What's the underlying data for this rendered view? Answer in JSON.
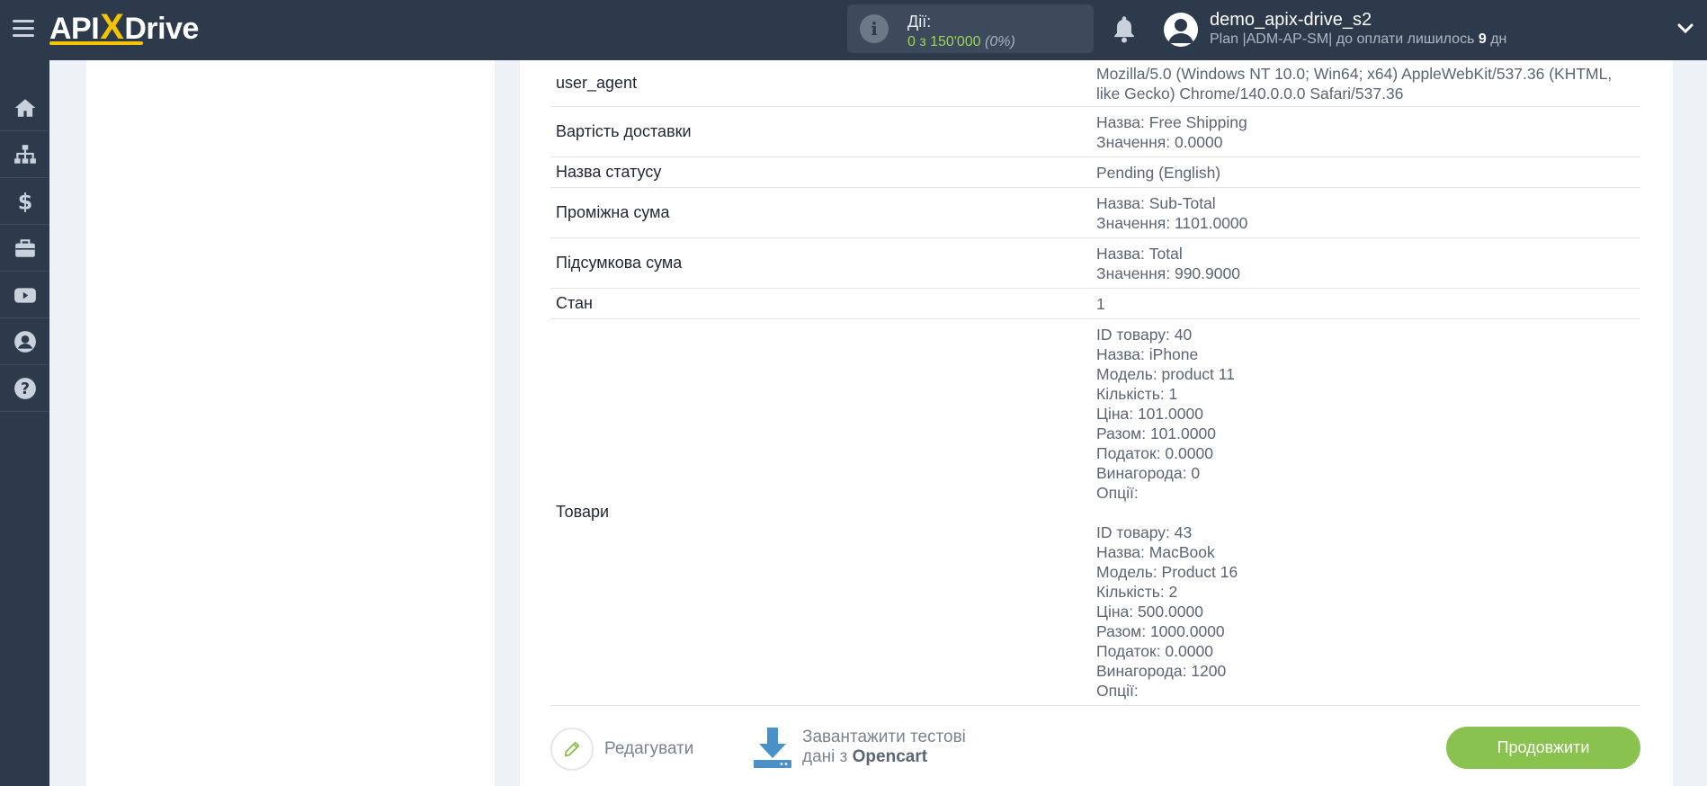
{
  "header": {
    "logo": {
      "left": "API",
      "x": "X",
      "right": "Drive"
    },
    "actions": {
      "label": "Дії:",
      "value": "0 з 150'000",
      "percent": "(0%)"
    },
    "user": {
      "name": "demo_apix-drive_s2",
      "plan_prefix": "Plan |ADM-AP-SM| до оплати лишилось ",
      "days": "9",
      "days_suffix": " дн"
    }
  },
  "sidebar": {
    "items": [
      "home-icon",
      "sitemap-icon",
      "dollar-icon",
      "briefcase-icon",
      "youtube-icon",
      "user-icon",
      "help-icon"
    ]
  },
  "table": {
    "rows": [
      {
        "key": "user_agent",
        "value": "Mozilla/5.0 (Windows NT 10.0; Win64; x64) AppleWebKit/537.36 (KHTML,\nlike Gecko) Chrome/140.0.0.0 Safari/537.36"
      },
      {
        "key": "Вартість доставки",
        "value": "Назва: Free Shipping\nЗначення: 0.0000"
      },
      {
        "key": "Назва статусу",
        "value": "Pending (English)"
      },
      {
        "key": "Проміжна сума",
        "value": "Назва: Sub-Total\nЗначення: 1101.0000"
      },
      {
        "key": "Підсумкова сума",
        "value": "Назва: Total\nЗначення: 990.9000"
      },
      {
        "key": "Стан",
        "value": "1"
      },
      {
        "key": "Товари",
        "value": "ID товару: 40\nНазва: iPhone\nМодель: product 11\nКількість: 1\nЦіна: 101.0000\nРазом: 101.0000\nПодаток: 0.0000\nВинагорода: 0\nОпції:\n\nID товару: 43\nНазва: MacBook\nМодель: Product 16\nКількість: 2\nЦіна: 500.0000\nРазом: 1000.0000\nПодаток: 0.0000\nВинагорода: 1200\nОпції:"
      }
    ]
  },
  "footer": {
    "edit_label": "Редагувати",
    "load_line1": "Завантажити тестові",
    "load_line2_prefix": "дані з ",
    "load_source": "Opencart",
    "continue_label": "Продовжити"
  }
}
